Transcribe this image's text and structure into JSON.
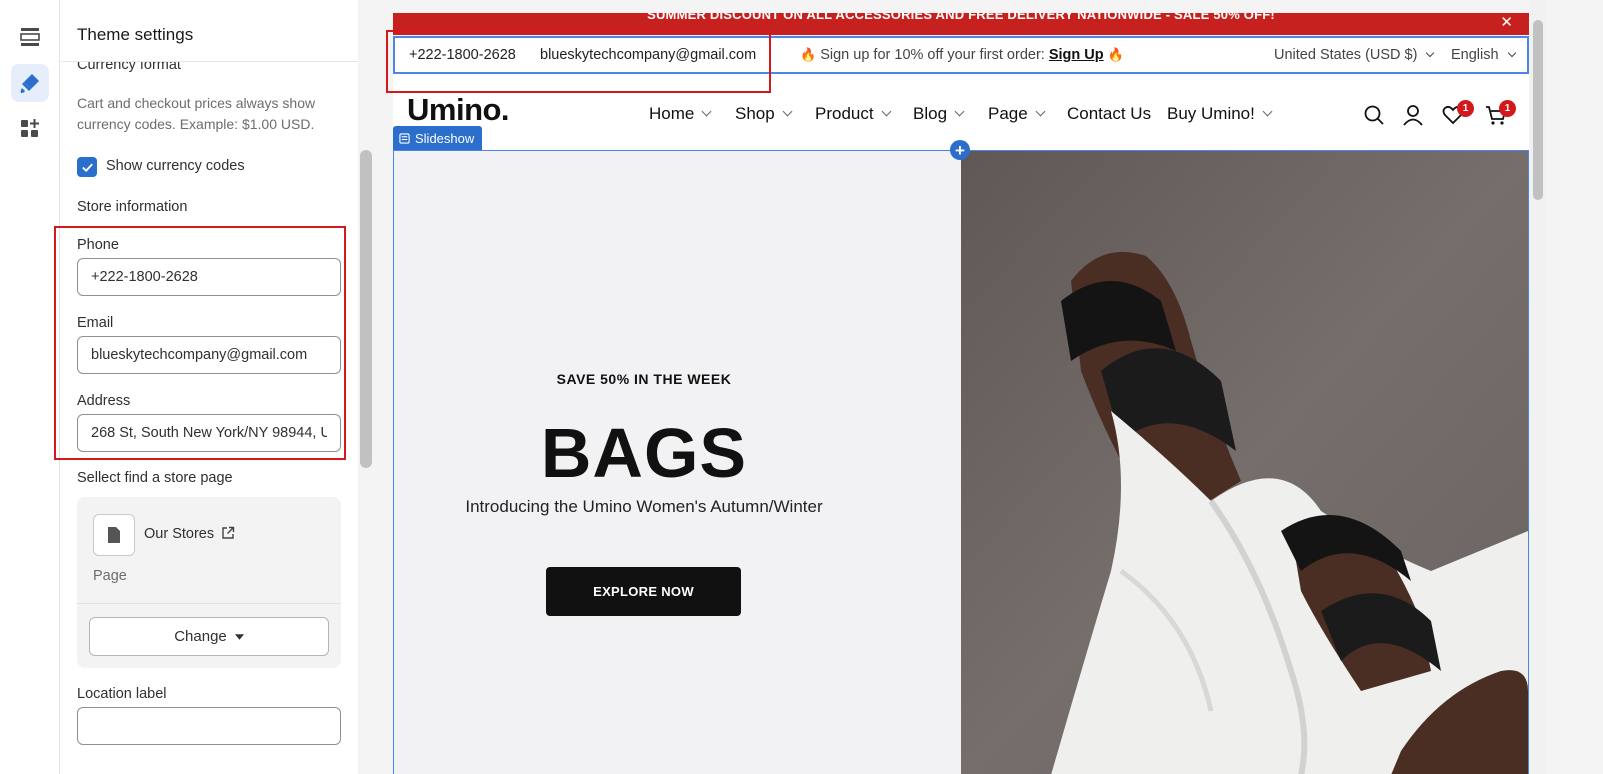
{
  "rail": {
    "items": [
      {
        "icon": "sections-icon"
      },
      {
        "icon": "theme-settings-brush-icon"
      },
      {
        "icon": "apps-add-icon"
      }
    ]
  },
  "panel": {
    "title": "Theme settings",
    "currency": {
      "title": "Currency format",
      "help": "Cart and checkout prices always show currency codes. Example: $1.00 USD.",
      "checkbox_label": "Show currency codes",
      "checked": true
    },
    "store": {
      "title": "Store information",
      "phone_label": "Phone",
      "phone_value": "+222-1800-2628",
      "email_label": "Email",
      "email_value": "blueskytechcompany@gmail.com",
      "address_label": "Address",
      "address_value": "268 St, South New York/NY 98944, U",
      "page_label": "Sellect find a store page",
      "page_name": "Our Stores",
      "page_type": "Page",
      "change_label": "Change",
      "location_label": "Location label",
      "location_value": ""
    }
  },
  "preview": {
    "announcement": "SUMMER DISCOUNT ON ALL ACCESSORIES AND FREE DELIVERY NATIONWIDE - SALE 50% OFF!",
    "announcement_close": "✕",
    "topbar": {
      "phone": "+222-1800-2628",
      "email": "blueskytechcompany@gmail.com",
      "promo_text": "Sign up for 10% off your first order:",
      "promo_link": "Sign Up",
      "currency": "United States (USD $)",
      "language": "English"
    },
    "header": {
      "logo": "Umino.",
      "nav": [
        "Home",
        "Shop",
        "Product",
        "Blog",
        "Page",
        "Contact Us",
        "Buy Umino!"
      ],
      "wishlist_count": "1",
      "cart_count": "1"
    },
    "section_tag": "Slideshow",
    "hero": {
      "subtitle": "SAVE 50% IN THE WEEK",
      "title": "BAGS",
      "description": "Introducing the Umino Women's Autumn/Winter",
      "button": "EXPLORE NOW"
    }
  },
  "colors": {
    "accent": "#2c6ecb",
    "announcement_bg": "#c7211f",
    "highlight": "#d3191b",
    "hero_bg": "#f2f2f4"
  }
}
